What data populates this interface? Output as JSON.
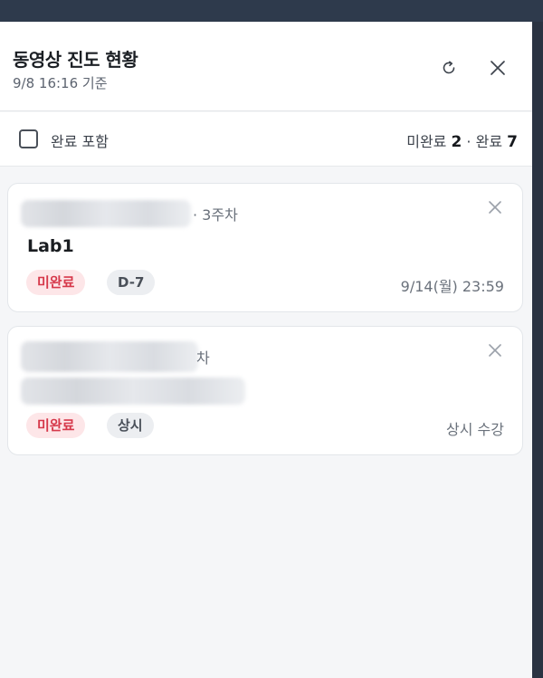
{
  "header": {
    "title": "동영상 진도 현황",
    "subtitle": "9/8 16:16 기준",
    "refresh_icon": "↻",
    "close_icon": "✕"
  },
  "filter": {
    "checkbox_label": "완료 포함",
    "checked": false,
    "incomplete_label": "미완료",
    "incomplete_count": "2",
    "separator": "·",
    "complete_label": "완료",
    "complete_count": "7"
  },
  "items": [
    {
      "course_suffix": "· 3주차",
      "title": "Lab1",
      "status": "미완료",
      "tag": "D-7",
      "due": "9/14(월) 23:59"
    },
    {
      "course_suffix": "차",
      "title": "",
      "status": "미완료",
      "tag": "상시",
      "due": "상시 수강"
    }
  ],
  "colors": {
    "topbar": "#2e3a4c",
    "badge_red_bg": "#fde6e8",
    "badge_red_text": "#d6384a",
    "badge_gray_bg": "#eceef1"
  }
}
